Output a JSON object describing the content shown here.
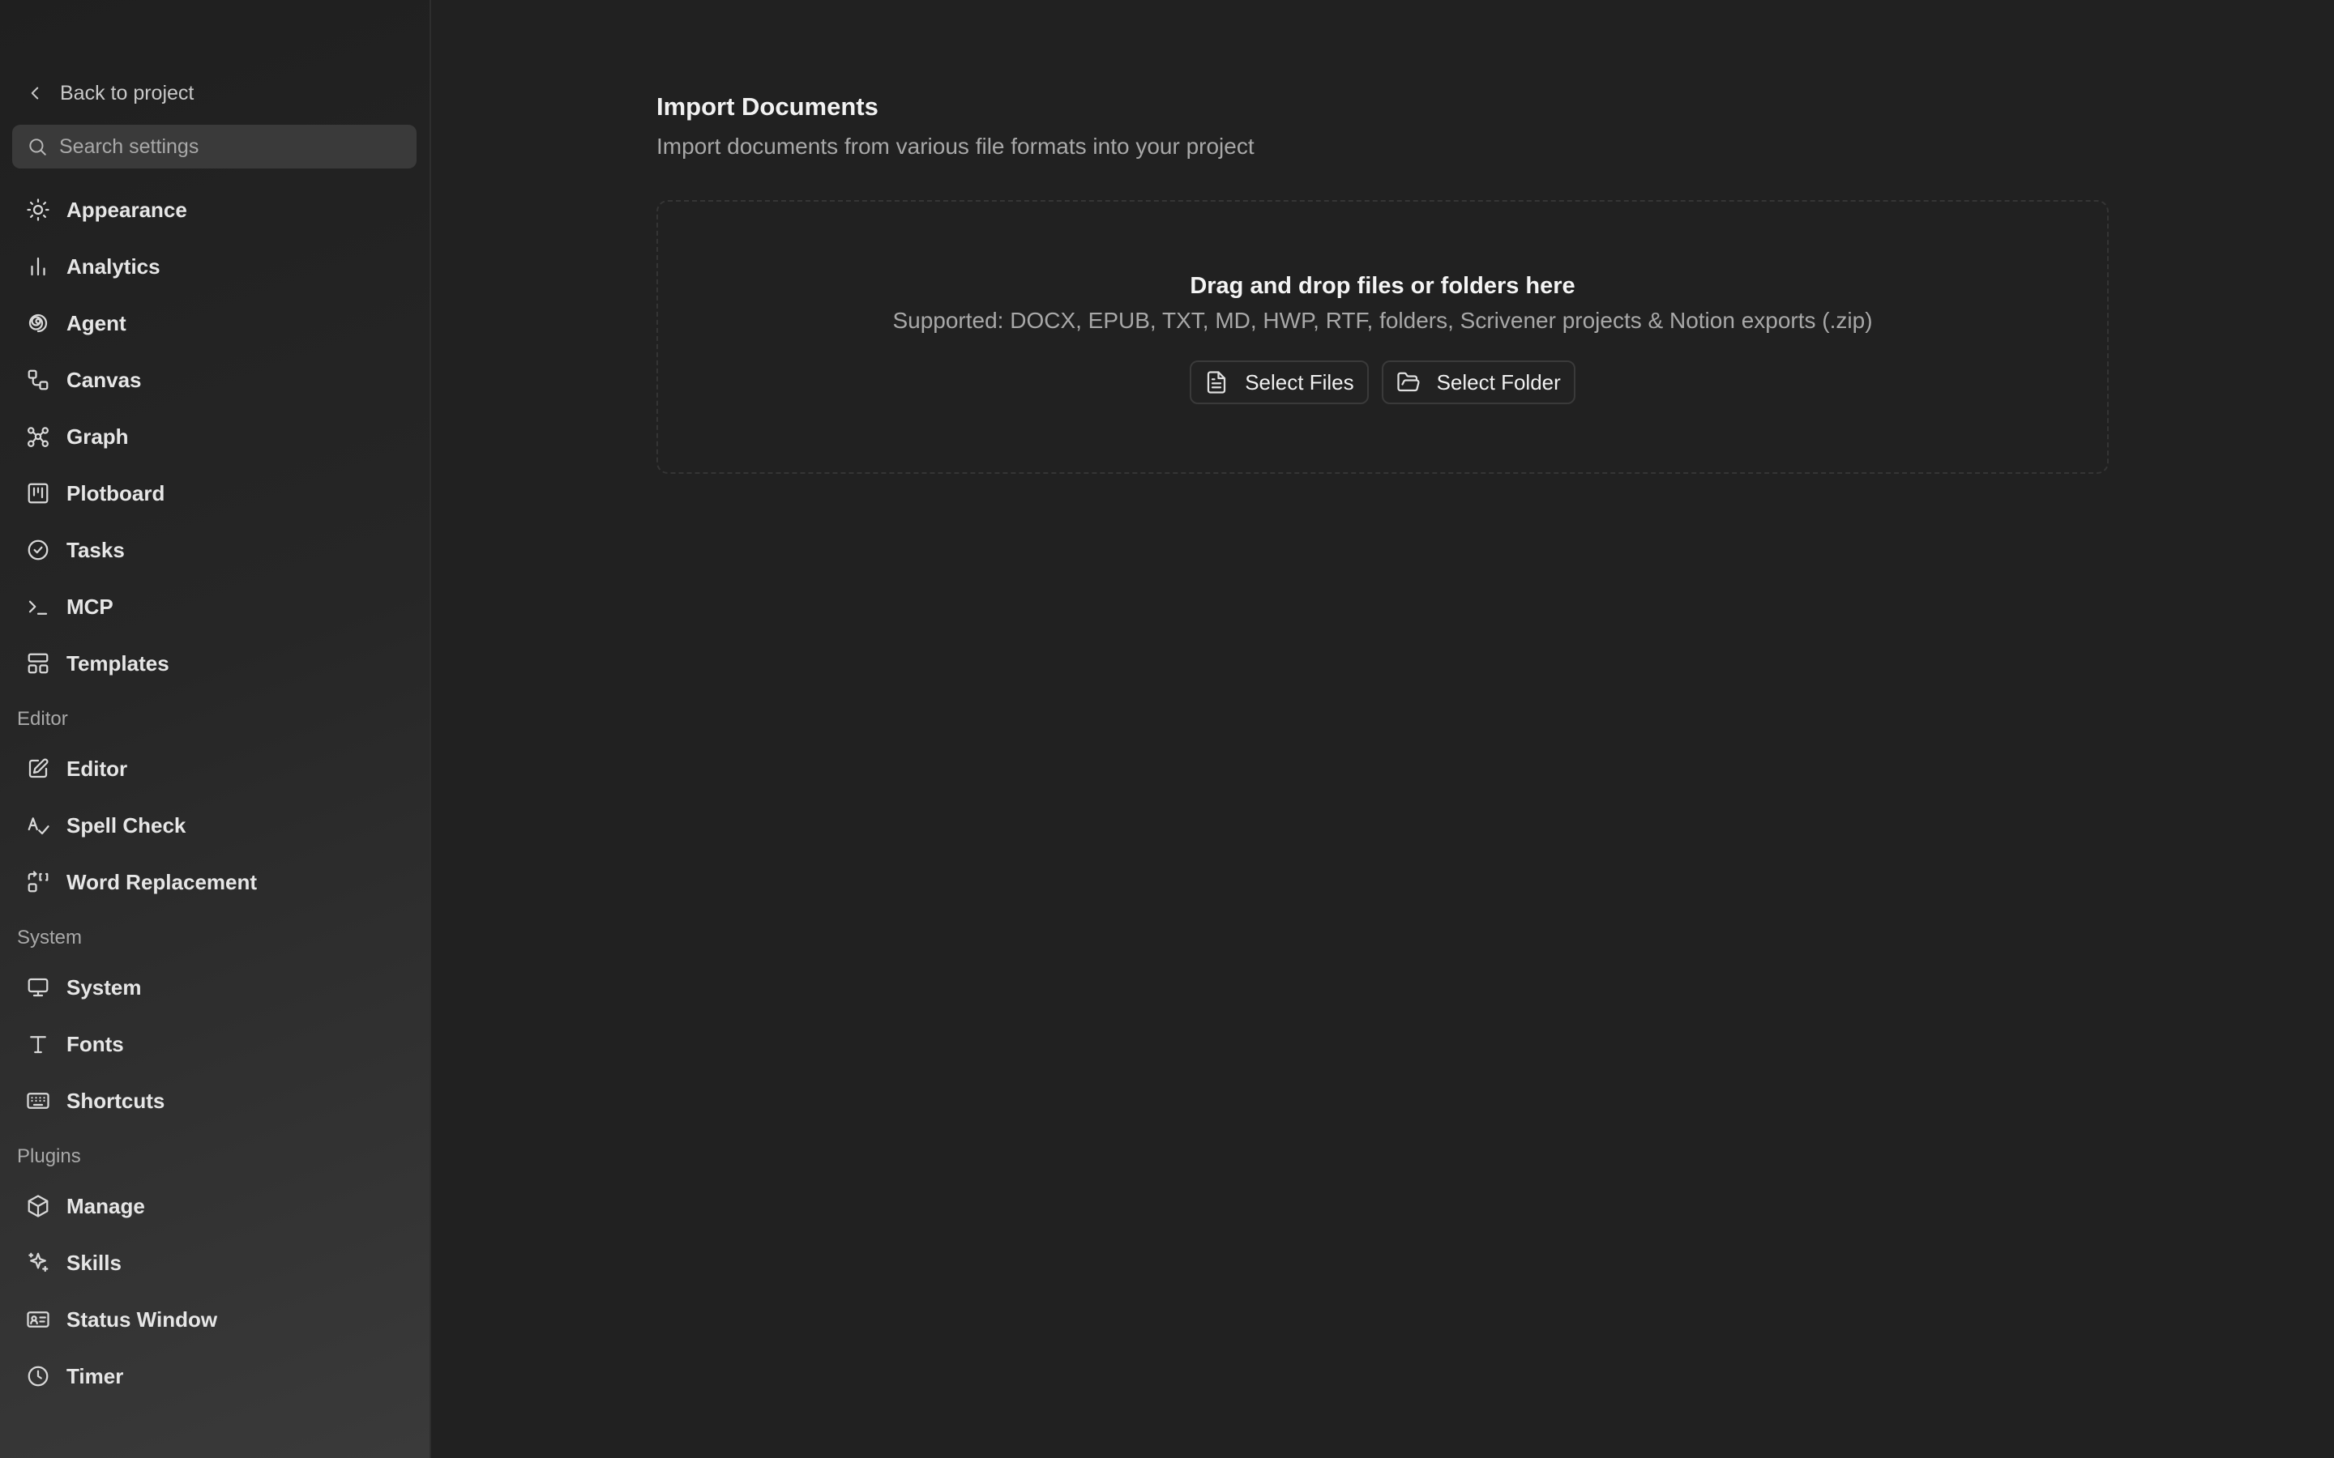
{
  "sidebar": {
    "back_label": "Back to project",
    "search_placeholder": "Search settings",
    "items_main": [
      {
        "label": "Appearance",
        "icon": "sun-icon"
      },
      {
        "label": "Analytics",
        "icon": "bar-chart-icon"
      },
      {
        "label": "Agent",
        "icon": "spiral-icon"
      },
      {
        "label": "Canvas",
        "icon": "workflow-icon"
      },
      {
        "label": "Graph",
        "icon": "graph-icon"
      },
      {
        "label": "Plotboard",
        "icon": "kanban-icon"
      },
      {
        "label": "Tasks",
        "icon": "check-circle-icon"
      },
      {
        "label": "MCP",
        "icon": "terminal-icon"
      },
      {
        "label": "Templates",
        "icon": "layout-icon"
      }
    ],
    "group_editor": {
      "label": "Editor",
      "items": [
        {
          "label": "Editor",
          "icon": "edit-icon"
        },
        {
          "label": "Spell Check",
          "icon": "spell-check-icon"
        },
        {
          "label": "Word Replacement",
          "icon": "replace-icon"
        }
      ]
    },
    "group_system": {
      "label": "System",
      "items": [
        {
          "label": "System",
          "icon": "monitor-icon"
        },
        {
          "label": "Fonts",
          "icon": "type-icon"
        },
        {
          "label": "Shortcuts",
          "icon": "keyboard-icon"
        }
      ]
    },
    "group_plugins": {
      "label": "Plugins",
      "items": [
        {
          "label": "Manage",
          "icon": "package-icon"
        },
        {
          "label": "Skills",
          "icon": "sparkles-icon"
        },
        {
          "label": "Status Window",
          "icon": "id-card-icon"
        },
        {
          "label": "Timer",
          "icon": "clock-icon"
        }
      ]
    }
  },
  "main": {
    "title": "Import Documents",
    "subtitle": "Import documents from various file formats into your project",
    "dropzone": {
      "title": "Drag and drop files or folders here",
      "supported": "Supported: DOCX, EPUB, TXT, MD, HWP, RTF, folders, Scrivener projects & Notion exports (.zip)",
      "select_files_label": "Select Files",
      "select_folder_label": "Select Folder"
    }
  }
}
